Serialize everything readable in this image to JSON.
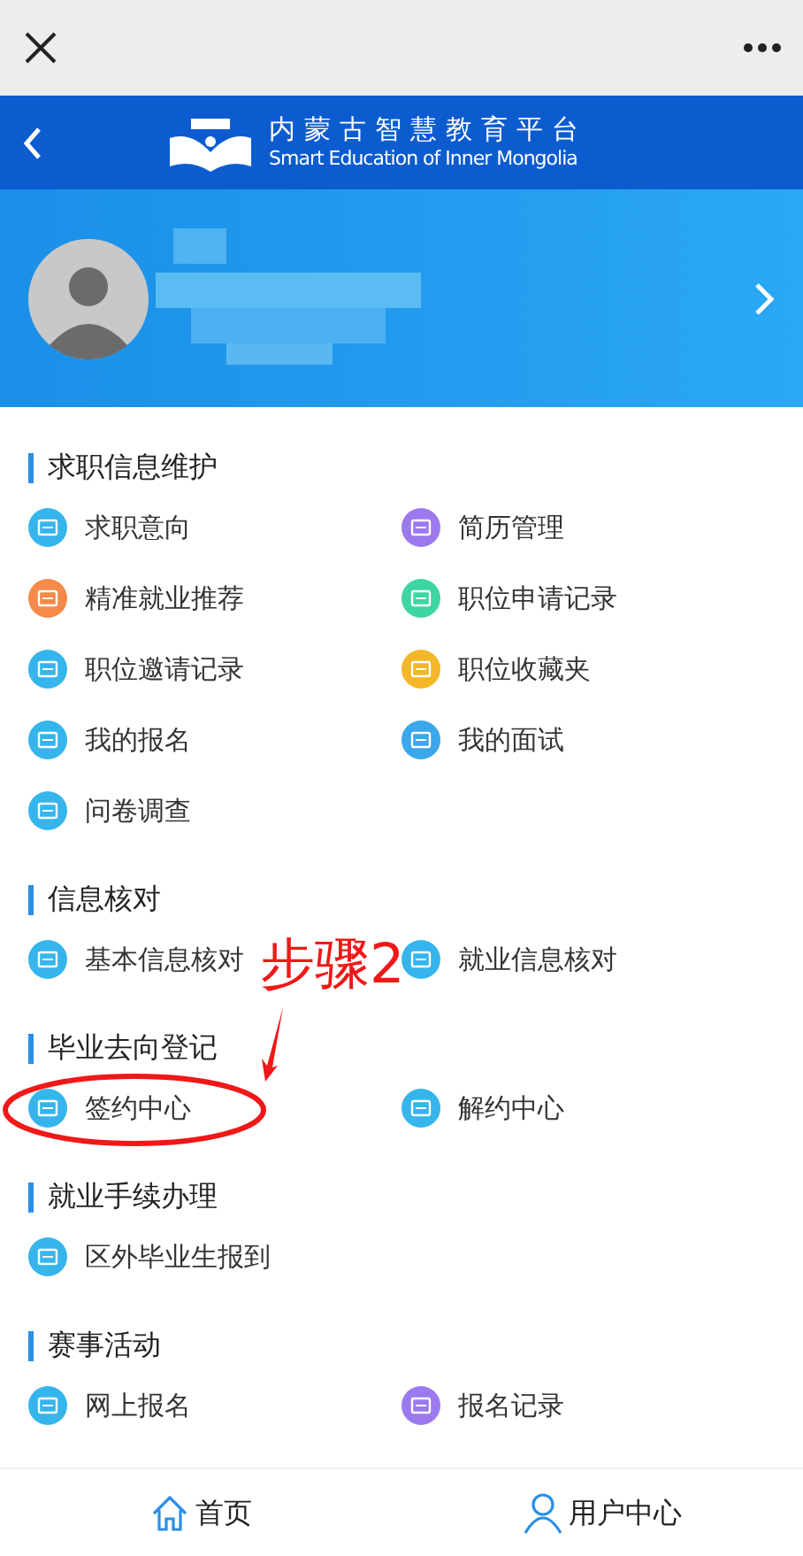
{
  "header": {
    "title_cn": "内蒙古智慧教育平台",
    "title_en": "Smart Education of Inner Mongolia"
  },
  "sections": [
    {
      "title": "求职信息维护",
      "items": [
        {
          "label": "求职意向",
          "color": "#35b5ec"
        },
        {
          "label": "简历管理",
          "color": "#9b7af0"
        },
        {
          "label": "精准就业推荐",
          "color": "#f58a4a"
        },
        {
          "label": "职位申请记录",
          "color": "#3dd6a0"
        },
        {
          "label": "职位邀请记录",
          "color": "#35b5ec"
        },
        {
          "label": "职位收藏夹",
          "color": "#f3b728"
        },
        {
          "label": "我的报名",
          "color": "#35b5ec"
        },
        {
          "label": "我的面试",
          "color": "#3ba7ec"
        },
        {
          "label": "问卷调查",
          "color": "#35b5ec"
        }
      ]
    },
    {
      "title": "信息核对",
      "items": [
        {
          "label": "基本信息核对",
          "color": "#35b5ec"
        },
        {
          "label": "就业信息核对",
          "color": "#35b5ec"
        }
      ]
    },
    {
      "title": "毕业去向登记",
      "items": [
        {
          "label": "签约中心",
          "color": "#35b5ec"
        },
        {
          "label": "解约中心",
          "color": "#35b5ec"
        }
      ]
    },
    {
      "title": "就业手续办理",
      "items": [
        {
          "label": "区外毕业生报到",
          "color": "#35b5ec"
        }
      ]
    },
    {
      "title": "赛事活动",
      "items": [
        {
          "label": "网上报名",
          "color": "#35b5ec"
        },
        {
          "label": "报名记录",
          "color": "#9b7af0"
        }
      ]
    }
  ],
  "annotation": {
    "text": "步骤2"
  },
  "tabbar": [
    {
      "label": "首页",
      "kind": "home"
    },
    {
      "label": "用户中心",
      "kind": "user"
    }
  ]
}
